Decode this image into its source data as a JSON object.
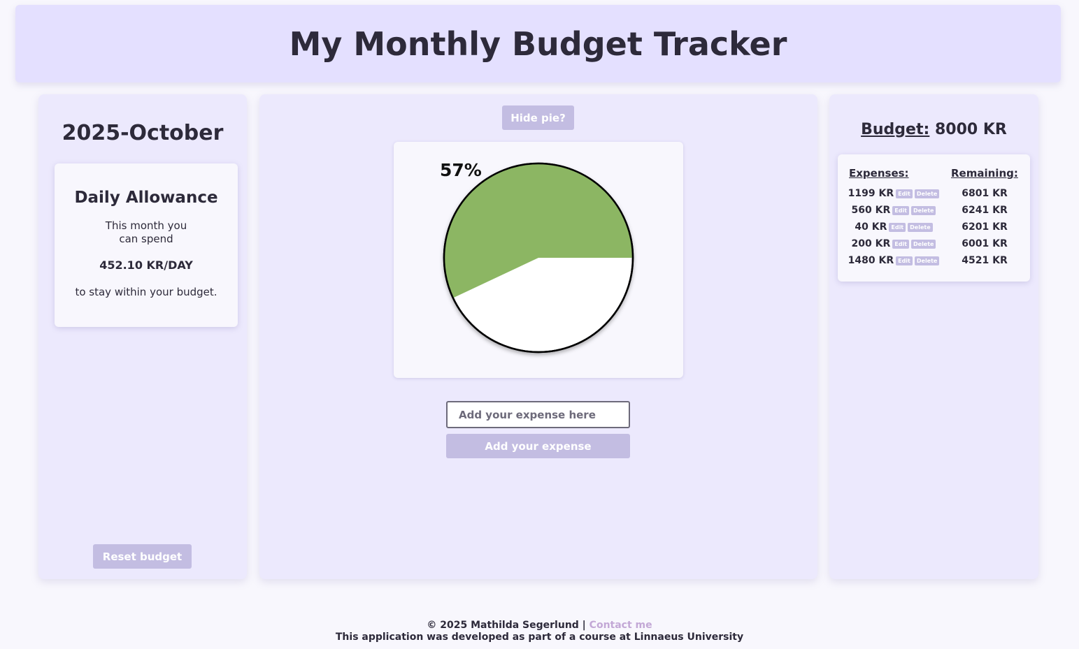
{
  "header": {
    "title": "My Monthly Budget Tracker"
  },
  "left_panel": {
    "month": "2025-October",
    "allowance": {
      "title": "Daily Allowance",
      "intro_line1": "This month you",
      "intro_line2": "can spend",
      "amount": "452.10 KR/DAY",
      "outro": "to stay within your budget."
    },
    "reset_label": "Reset budget"
  },
  "center_panel": {
    "hide_pie_label": "Hide pie?",
    "pie": {
      "percent_label": "57%",
      "remaining_fraction": 0.57,
      "fill_color": "#8cb663",
      "empty_color": "#ffffff"
    },
    "expense_placeholder": "Add your expense here",
    "add_label": "Add your expense"
  },
  "right_panel": {
    "budget_label": "Budget:",
    "budget_value": "8000 KR",
    "expenses_header": "Expenses:",
    "remaining_header": "Remaining:",
    "edit_label": "Edit",
    "delete_label": "Delete",
    "rows": [
      {
        "expense": "1199 KR",
        "remaining": "6801 KR"
      },
      {
        "expense": "560 KR",
        "remaining": "6241 KR"
      },
      {
        "expense": "40 KR",
        "remaining": "6201 KR"
      },
      {
        "expense": "200 KR",
        "remaining": "6001 KR"
      },
      {
        "expense": "1480 KR",
        "remaining": "4521 KR"
      }
    ]
  },
  "footer": {
    "copyright": "© 2025 Mathilda Segerlund |",
    "contact": "Contact me",
    "note": "This application was developed as part of a course at Linnaeus University"
  }
}
